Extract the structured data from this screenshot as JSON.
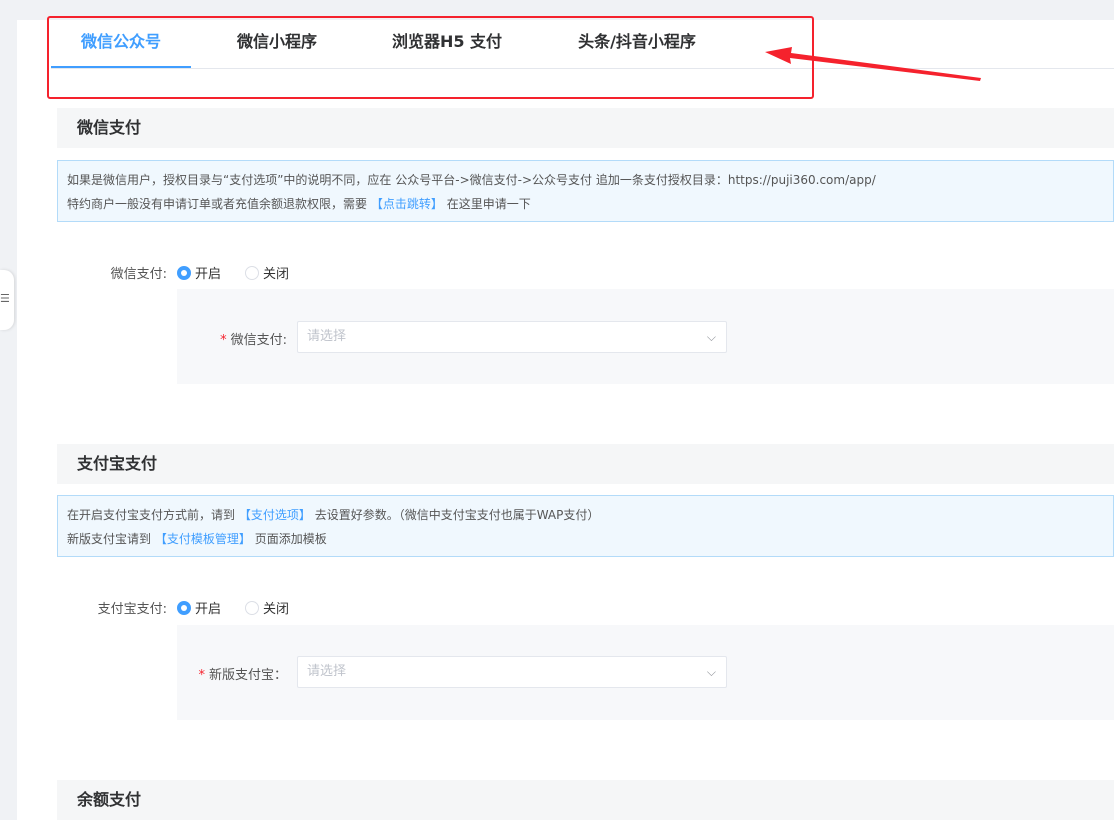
{
  "tabs": [
    {
      "label": "微信公众号",
      "active": true
    },
    {
      "label": "微信小程序"
    },
    {
      "label": "浏览器H5 支付"
    },
    {
      "label": "头条/抖音小程序"
    }
  ],
  "colors": {
    "accent": "#409eff",
    "annotation": "#f5222d",
    "required": "#f5222d"
  },
  "sidebar_toggle_icon": "menu-fold-icon",
  "wechat": {
    "title": "微信支付",
    "info_line1": "如果是微信用户，授权目录与“支付选项”中的说明不同，应在 公众号平台->微信支付->公众号支付 追加一条支付授权目录：https://puji360.com/app/",
    "info_line2_pre": "特约商户一般没有申请订单或者充值余额退款权限，需要",
    "info_line2_link": "【点击跳转】",
    "info_line2_post": "在这里申请一下",
    "toggle_label": "微信支付:",
    "on": "开启",
    "off": "关闭",
    "select_label": "微信支付:",
    "select_placeholder": "请选择"
  },
  "alipay": {
    "title": "支付宝支付",
    "info_line1_pre": "在开启支付宝支付方式前，请到",
    "info_line1_link": "【支付选项】",
    "info_line1_post": "去设置好参数。（微信中支付宝支付也属于WAP支付）",
    "info_line2_pre": "新版支付宝请到",
    "info_line2_link": "【支付模板管理】",
    "info_line2_post": "页面添加模板",
    "toggle_label": "支付宝支付:",
    "on": "开启",
    "off": "关闭",
    "select_label": "新版支付宝：",
    "select_placeholder": "请选择"
  },
  "balance": {
    "title": "余额支付"
  }
}
